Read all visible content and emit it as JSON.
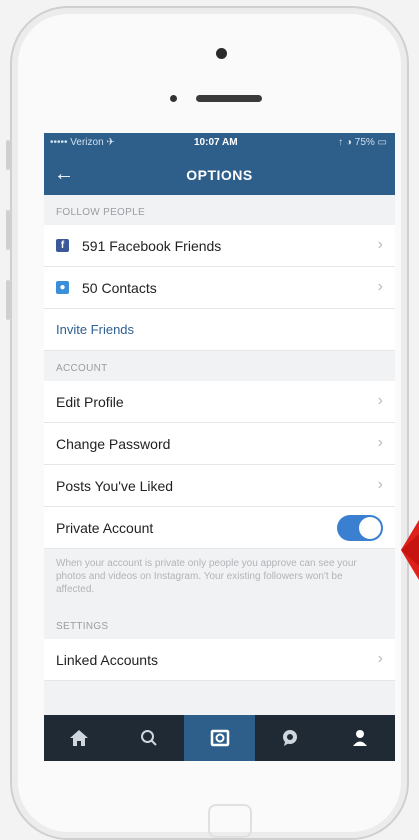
{
  "status_bar": {
    "carrier": "••••• Verizon ✈",
    "time": "10:07 AM",
    "battery": "↑ ◑ 75% ▭"
  },
  "nav": {
    "title": "OPTIONS"
  },
  "follow_people": {
    "header": "FOLLOW PEOPLE",
    "items": [
      {
        "label": "591 Facebook Friends",
        "icon": "facebook-icon"
      },
      {
        "label": "50 Contacts",
        "icon": "contacts-icon"
      }
    ],
    "invite_label": "Invite Friends"
  },
  "account": {
    "header": "ACCOUNT",
    "items": [
      {
        "label": "Edit Profile"
      },
      {
        "label": "Change Password"
      },
      {
        "label": "Posts You've Liked"
      }
    ],
    "private_label": "Private Account",
    "private_on": true,
    "private_note": "When your account is private only people you approve can see your photos and videos on Instagram. Your existing followers won't be affected."
  },
  "settings": {
    "header": "SETTINGS",
    "linked_label": "Linked Accounts"
  },
  "tabbar": {
    "tabs": [
      "home-icon",
      "search-icon",
      "camera-icon",
      "activity-icon",
      "profile-icon"
    ],
    "active_index": 2
  },
  "colors": {
    "nav": "#2e5f8a",
    "tabbar": "#1f2a35",
    "toggle": "#3a7fd0",
    "arrow": "#e0211b"
  }
}
